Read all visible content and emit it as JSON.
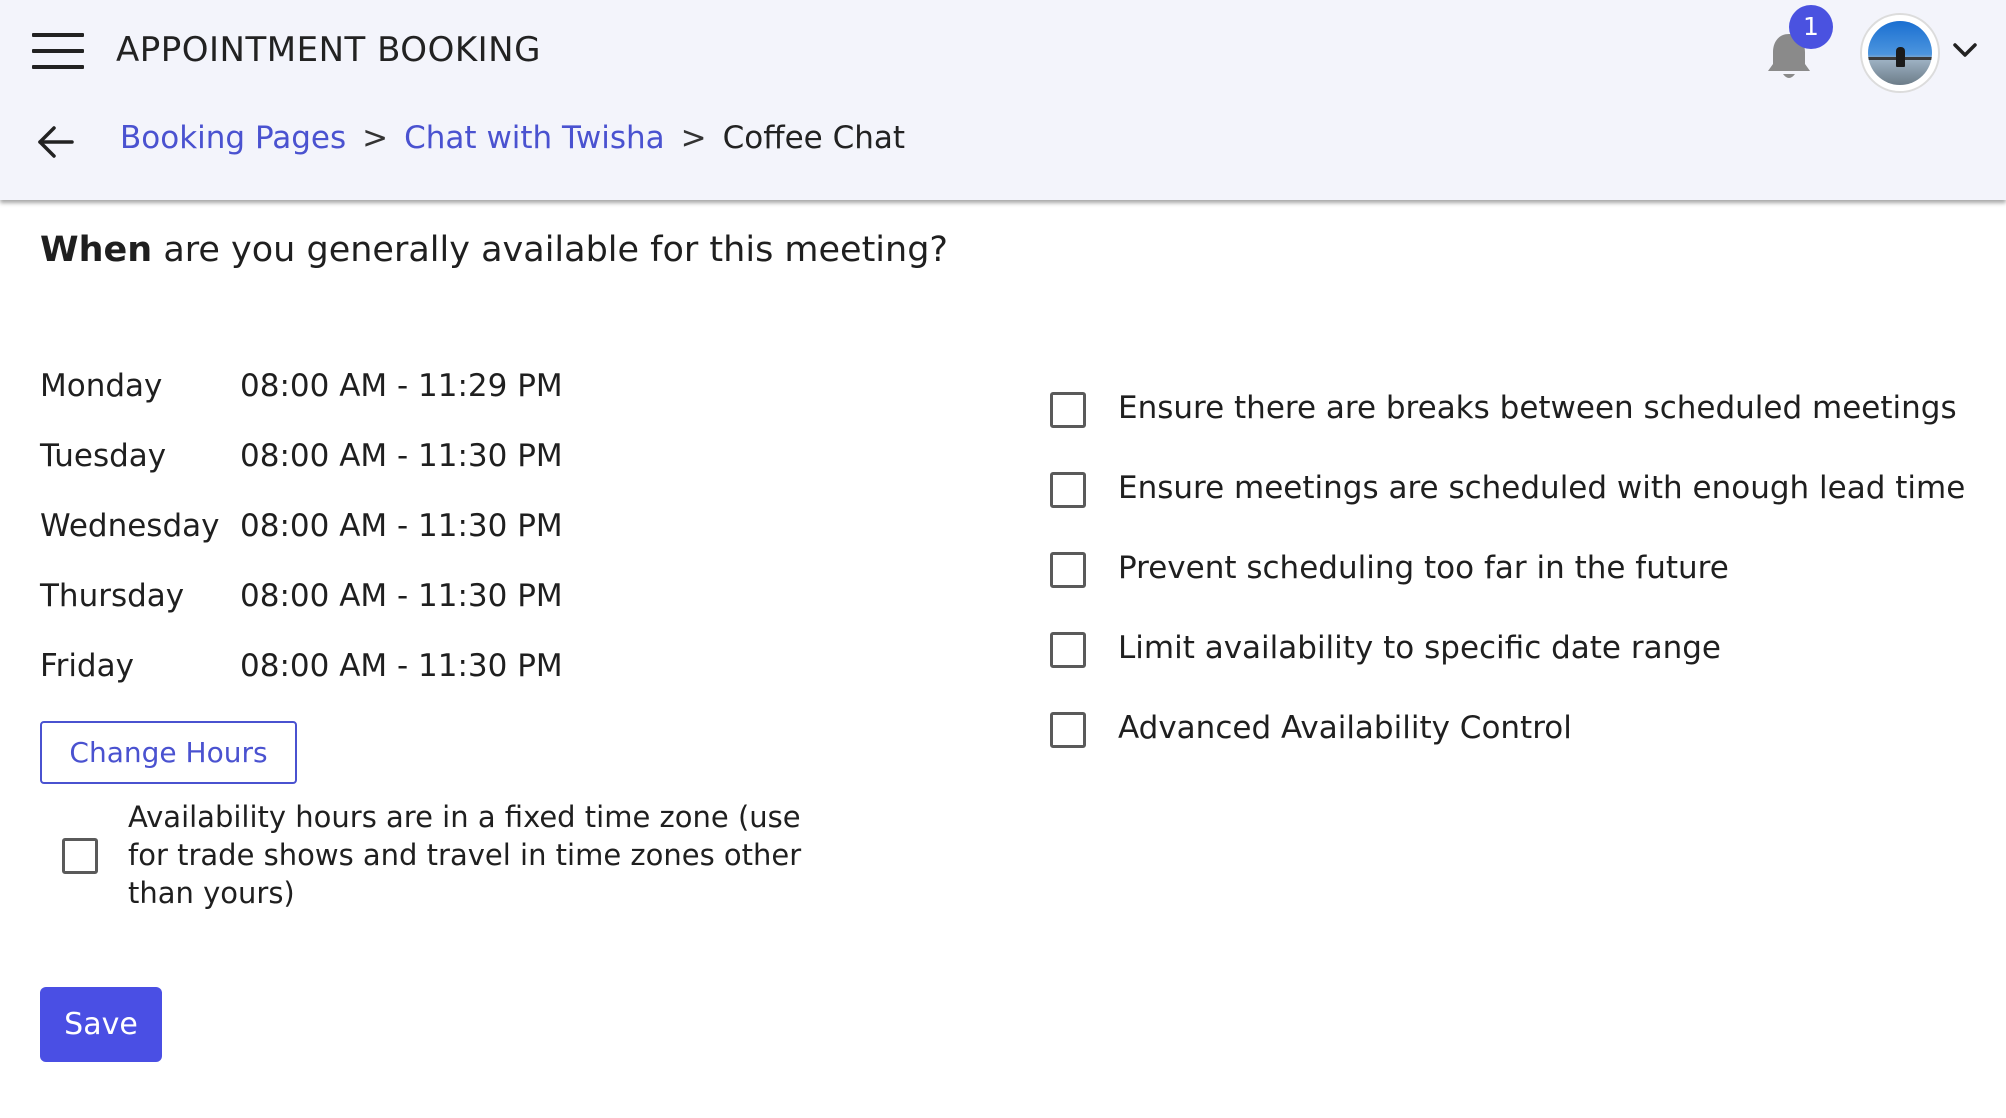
{
  "header": {
    "app_title": "APPOINTMENT BOOKING",
    "notification_count": "1"
  },
  "breadcrumb": {
    "items": [
      "Booking Pages",
      "Chat with Twisha"
    ],
    "current": "Coffee Chat",
    "separator": ">"
  },
  "question": {
    "bold": "When",
    "rest": "are you generally available for this meeting?"
  },
  "schedule": [
    {
      "day": "Monday",
      "hours": "08:00 AM - 11:29 PM"
    },
    {
      "day": "Tuesday",
      "hours": "08:00 AM - 11:30 PM"
    },
    {
      "day": "Wednesday",
      "hours": "08:00 AM - 11:30 PM"
    },
    {
      "day": "Thursday",
      "hours": "08:00 AM - 11:30 PM"
    },
    {
      "day": "Friday",
      "hours": "08:00 AM - 11:30 PM"
    }
  ],
  "change_hours_label": "Change Hours",
  "fixed_timezone": {
    "label": "Availability hours are in a fixed time zone (use for trade shows and travel in time zones other than yours)",
    "checked": false
  },
  "save_label": "Save",
  "options": [
    {
      "label": "Ensure there are breaks between scheduled meetings",
      "checked": false
    },
    {
      "label": "Ensure meetings are scheduled with enough lead time",
      "checked": false
    },
    {
      "label": "Prevent scheduling too far in the future",
      "checked": false
    },
    {
      "label": "Limit availability to specific date range",
      "checked": false
    },
    {
      "label": "Advanced Availability Control",
      "checked": false
    }
  ],
  "colors": {
    "accent": "#4a4fe4",
    "link": "#4a52d0",
    "header_bg": "#f3f4fb"
  },
  "icons": [
    "menu-icon",
    "bell-icon",
    "avatar",
    "chevron-down-icon",
    "back-arrow-icon",
    "checkbox"
  ]
}
